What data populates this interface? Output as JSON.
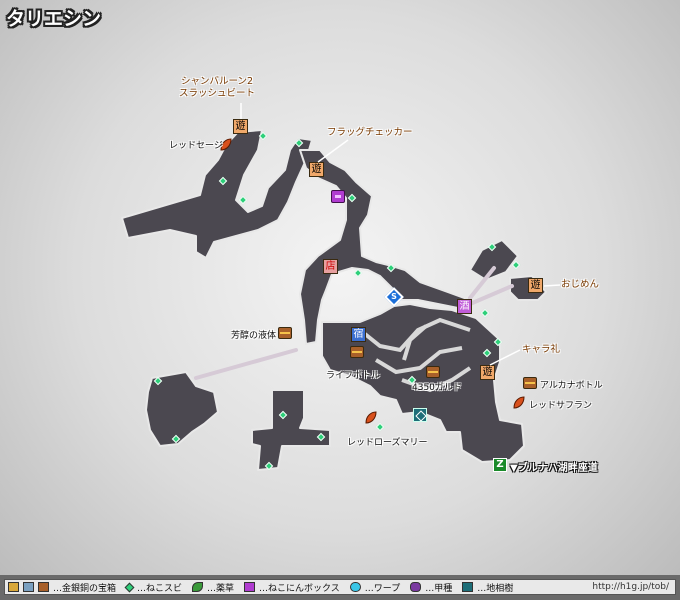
{
  "map": {
    "title": "タリエシン",
    "exit_label": "▼ブルナハ湖畔座道",
    "labels": {
      "balloon": "シャンバルーン2\nスラッシュビート",
      "flag": "フラッグチェッカー",
      "ojimen": "おじめん",
      "kyara": "キャラ礼",
      "red_sage": "レッドセージ",
      "houbo": "芳醇の液体",
      "life": "ライフボトル",
      "gald": "4350ガルド",
      "arcana": "アルカナボトル",
      "saffron": "レッドサフラン",
      "rosemary": "レッドローズマリー"
    },
    "icons": {
      "play": "遊",
      "shop": "店",
      "inn": "宿",
      "bar": "酒",
      "warp": "S",
      "exit": "Z"
    }
  },
  "legend": {
    "items": [
      {
        "label": "…金銀銅の宝箱",
        "icon": "chest-icon"
      },
      {
        "label": "…ねこスビ",
        "icon": "diamond-icon"
      },
      {
        "label": "…薬草",
        "icon": "leaf-icon"
      },
      {
        "label": "…ねこにんボックス",
        "icon": "cat-box-icon"
      },
      {
        "label": "…ワープ",
        "icon": "warp-icon"
      },
      {
        "label": "…甲種",
        "icon": "shell-icon"
      },
      {
        "label": "…地相樹",
        "icon": "tree-icon"
      }
    ],
    "url": "http://h1g.jp/tob/"
  },
  "colors": {
    "terrain": "#4b4850",
    "terrain_edge": "#e8e8e8",
    "chest": "#a8602a",
    "cat_diamond": "#2ed07a",
    "play_icon": "#f0a86a",
    "orange_label": "#7a3a00"
  }
}
